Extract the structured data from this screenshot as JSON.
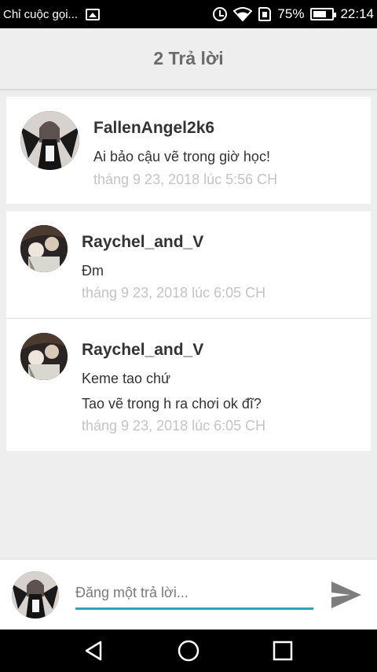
{
  "status_bar": {
    "notification_text": "Chỉ cuộc gọi...",
    "battery_percent": "75%",
    "battery_level": 0.75,
    "time": "22:14",
    "icons": [
      "image-icon",
      "alarm-icon",
      "wifi-icon",
      "sim-icon",
      "battery-icon"
    ]
  },
  "header": {
    "title": "2 Trả lời"
  },
  "original_comment": {
    "user": "FallenAngel2k6",
    "text": "Ai bảo cậu vẽ trong giờ học!",
    "time": "tháng 9 23, 2018 lúc 5:56 CH"
  },
  "replies": [
    {
      "user": "Raychel_and_V",
      "lines": [
        "Đm"
      ],
      "time": "tháng 9 23, 2018 lúc 6:05 CH"
    },
    {
      "user": "Raychel_and_V",
      "lines": [
        "Keme tao chứ",
        "Tao vẽ trong h ra chơi ok đĩ?"
      ],
      "time": "tháng 9 23, 2018 lúc 6:05 CH"
    }
  ],
  "reply_bar": {
    "placeholder": "Đăng một trả lời...",
    "value": ""
  },
  "colors": {
    "accent": "#2aa8b5",
    "background": "#eeeeee",
    "timestamp": "#c4c4c4",
    "send_icon": "#7d7d7d"
  }
}
